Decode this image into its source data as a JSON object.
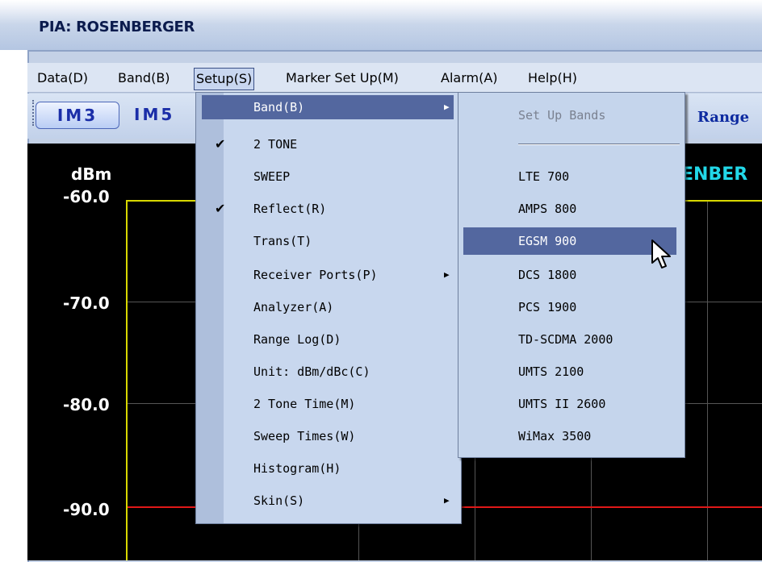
{
  "window": {
    "title": "PIA: ROSENBERGER"
  },
  "menubar": [
    {
      "id": "data",
      "label": "Data(D)"
    },
    {
      "id": "band",
      "label": "Band(B)"
    },
    {
      "id": "setup",
      "label": "Setup(S)"
    },
    {
      "id": "marker",
      "label": "Marker Set Up(M)"
    },
    {
      "id": "alarm",
      "label": "Alarm(A)"
    },
    {
      "id": "help",
      "label": "Help(H)"
    }
  ],
  "toolbar": {
    "im3": "IM3",
    "im5": "IM5",
    "range": "Range"
  },
  "plot": {
    "unit": "dBm",
    "y_ticks": [
      "-60.0",
      "-70.0",
      "-80.0",
      "-90.0"
    ],
    "brand_fragment": "ENBER"
  },
  "setup_menu": [
    {
      "label": "Band(B)",
      "checked": false,
      "submenu": true,
      "highlighted": true
    },
    {
      "label": "2 TONE",
      "checked": true,
      "submenu": false
    },
    {
      "label": "SWEEP",
      "checked": false,
      "submenu": false
    },
    {
      "label": "Reflect(R)",
      "checked": true,
      "submenu": false
    },
    {
      "label": "Trans(T)",
      "checked": false,
      "submenu": false
    },
    {
      "label": "Receiver Ports(P)",
      "checked": false,
      "submenu": true
    },
    {
      "label": "Analyzer(A)",
      "checked": false,
      "submenu": false
    },
    {
      "label": "Range Log(D)",
      "checked": false,
      "submenu": false
    },
    {
      "label": "Unit: dBm/dBc(C)",
      "checked": false,
      "submenu": false
    },
    {
      "label": "2 Tone Time(M)",
      "checked": false,
      "submenu": false
    },
    {
      "label": "Sweep Times(W)",
      "checked": false,
      "submenu": false
    },
    {
      "label": "Histogram(H)",
      "checked": false,
      "submenu": false
    },
    {
      "label": "Skin(S)",
      "checked": false,
      "submenu": true
    }
  ],
  "band_submenu": {
    "header": "Set Up Bands",
    "items": [
      "LTE 700",
      "AMPS 800",
      "EGSM 900",
      "DCS 1800",
      "PCS 1900",
      "TD-SCDMA 2000",
      "UMTS 2100",
      "UMTS II 2600",
      "WiMax 3500"
    ],
    "highlighted": "EGSM 900"
  },
  "icons": {
    "check": "checkmark-icon",
    "submenu": "submenu-arrow-icon",
    "cursor": "mouse-pointer-icon"
  },
  "colors": {
    "plot_bg": "#000000",
    "trace_yellow": "#d8d800",
    "limit_red": "#e01818",
    "highlight": "#53679f"
  }
}
